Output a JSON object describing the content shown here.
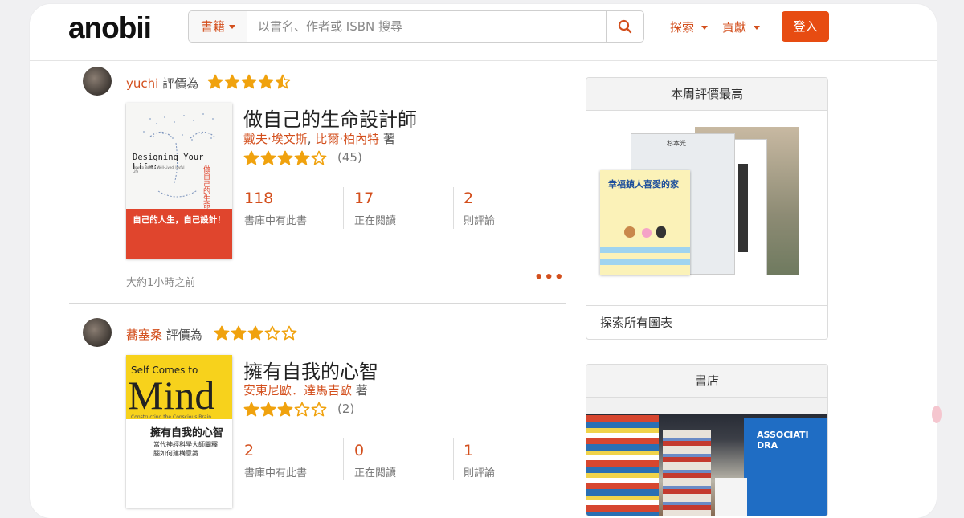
{
  "header": {
    "logo": "anobii",
    "search_category": "書籍",
    "search_placeholder": "以書名、作者或 ISBN 搜尋",
    "nav": [
      "探索",
      "貢獻"
    ],
    "login_label": "登入"
  },
  "feed": [
    {
      "reviewer": "yuchi",
      "rated_label": "評價為",
      "user_rating": 4.5,
      "book": {
        "title": "做自己的生命設計師",
        "authors": [
          "戴夫·埃文斯",
          "比爾·柏內特"
        ],
        "author_suffix": "著",
        "avg_rating": 4,
        "rating_count": "(45)",
        "cover_title_en": "Designing Your Life:",
        "cover_subtitle_en": "How to Build a Well-Lived, Joyful Life",
        "cover_title_zh": "自己的人生，自己設計！",
        "cover_side_zh": "做自己的生命設計師"
      },
      "stats": [
        {
          "num": "118",
          "label": "書庫中有此書"
        },
        {
          "num": "17",
          "label": "正在閱讀"
        },
        {
          "num": "2",
          "label": "則評論"
        }
      ],
      "time_ago": "大約1小時之前"
    },
    {
      "reviewer": "蕎塞桑",
      "rated_label": "評價為",
      "user_rating": 3,
      "book": {
        "title": "擁有自我的心智",
        "authors": [
          "安東尼歐．達馬吉歐"
        ],
        "author_suffix": "著",
        "avg_rating": 3,
        "rating_count": "(2)",
        "cover_title_en_1": "Self Comes to",
        "cover_title_en_2": "Mind",
        "cover_subtitle_en": "Constructing the Conscious Brain",
        "cover_title_zh": "擁有自我的心智",
        "cover_sub_zh": "當代神經科學大師闡釋 腦如何建構意識"
      },
      "stats": [
        {
          "num": "2",
          "label": "書庫中有此書"
        },
        {
          "num": "0",
          "label": "正在閱讀"
        },
        {
          "num": "1",
          "label": "則評論"
        }
      ]
    }
  ],
  "sidebar": {
    "top_rated_title": "本周評價最高",
    "explore_charts": "探索所有圖表",
    "top_rated_cover_front": "幸福鎮人喜愛的家",
    "top_rated_cover_back": "杉本光",
    "store_title": "書店",
    "store_sign": "ASSOCIATI DRA"
  },
  "colors": {
    "accent": "#d34f1d",
    "login_bg": "#e74c12",
    "star": "#f0a20e"
  }
}
